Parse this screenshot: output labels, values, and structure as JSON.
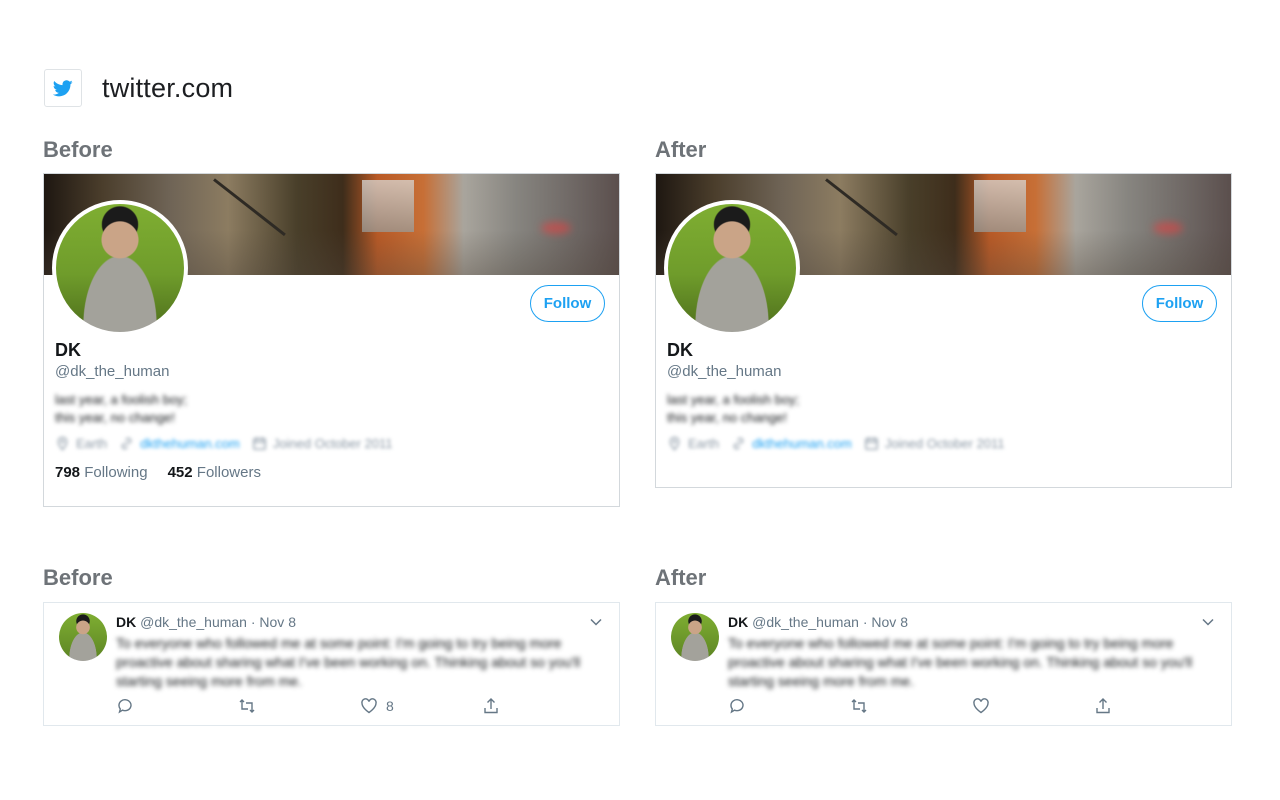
{
  "site": {
    "name": "twitter.com",
    "icon": "twitter-bird-icon",
    "brand_color": "#1da1f2"
  },
  "profile_before": {
    "section_label": "Before",
    "name": "DK",
    "handle": "@dk_the_human",
    "bio_line1": "last year, a foolish boy;",
    "bio_line2": "this year, no change!",
    "location": "Earth",
    "website": "dkthehuman.com",
    "joined": "Joined October 2011",
    "follow_label": "Follow",
    "following_count": "798",
    "following_label": "Following",
    "followers_count": "452",
    "followers_label": "Followers"
  },
  "profile_after": {
    "section_label": "After",
    "name": "DK",
    "handle": "@dk_the_human",
    "bio_line1": "last year, a foolish boy;",
    "bio_line2": "this year, no change!",
    "location": "Earth",
    "website": "dkthehuman.com",
    "joined": "Joined October 2011",
    "follow_label": "Follow"
  },
  "tweet_before": {
    "section_label": "Before",
    "name": "DK",
    "handle": "@dk_the_human",
    "date": "· Nov 8",
    "text": "To everyone who followed me at some point: I'm going to try being more proactive about sharing what I've been working on. Thinking about so you'll starting seeing more from me.",
    "like_count": "8"
  },
  "tweet_after": {
    "section_label": "After",
    "name": "DK",
    "handle": "@dk_the_human",
    "date": "· Nov 8",
    "text": "To everyone who followed me at some point: I'm going to try being more proactive about sharing what I've been working on. Thinking about so you'll starting seeing more from me."
  }
}
